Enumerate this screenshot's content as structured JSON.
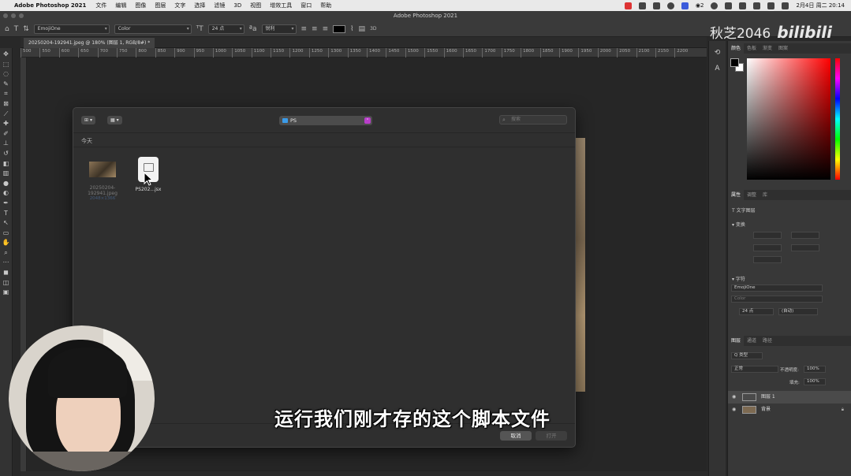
{
  "menubar": {
    "apple": "",
    "app": "Adobe Photoshop 2021",
    "items": [
      "文件",
      "编辑",
      "图像",
      "图层",
      "文字",
      "选择",
      "滤镜",
      "3D",
      "视图",
      "增效工具",
      "窗口",
      "帮助"
    ],
    "clock": "2月4日 周二 20:14",
    "wechat_badge": "2"
  },
  "window": {
    "title": "Adobe Photoshop 2021"
  },
  "options": {
    "font_family": "EmojiOne",
    "font_style": "Color",
    "font_size": "24 点",
    "aa": "锐利"
  },
  "brand": {
    "name": "秋芝2046",
    "site": "bilibili"
  },
  "doc_tab": "20250204-192941.jpeg @ 180% (图层 1, RGB/8#) *",
  "ruler_marks": [
    "500",
    "550",
    "600",
    "650",
    "700",
    "750",
    "800",
    "850",
    "900",
    "950",
    "1000",
    "1050",
    "1100",
    "1150",
    "1200",
    "1250",
    "1300",
    "1350",
    "1400",
    "1450",
    "1500",
    "1550",
    "1600",
    "1650",
    "1700",
    "1750",
    "1800",
    "1850",
    "1900",
    "1950",
    "2000",
    "2050",
    "2100",
    "2150",
    "2200"
  ],
  "dialog": {
    "view_icon": "⊞",
    "group_icon": "▦",
    "location": "PS",
    "search_placeholder": "搜索",
    "section": "今天",
    "files": [
      {
        "name": "20250204-192941.jpeg",
        "meta": "2048×1366",
        "dim": true
      },
      {
        "name": "PS202...jsx",
        "meta": "",
        "dim": false
      }
    ],
    "cancel": "取消",
    "open": "打开"
  },
  "subtitle": "运行我们刚才存的这个脚本文件",
  "panels": {
    "color_tabs": [
      "颜色",
      "色板",
      "渐变",
      "图案"
    ],
    "props_tabs": [
      "属性",
      "调整",
      "库"
    ],
    "layer_type": "文字图层",
    "transform": "变换",
    "char": "字符",
    "font": "EmojiOne",
    "style": "Color",
    "size": "24 点",
    "leading": "(自动)",
    "layers_tabs": [
      "图层",
      "通道",
      "路径"
    ],
    "kind": "Q 类型",
    "blend": "正常",
    "opacity_label": "不透明度:",
    "opacity": "100%",
    "fill_label": "填充:",
    "fill": "100%",
    "layers": [
      "图层 1",
      "背景"
    ]
  }
}
